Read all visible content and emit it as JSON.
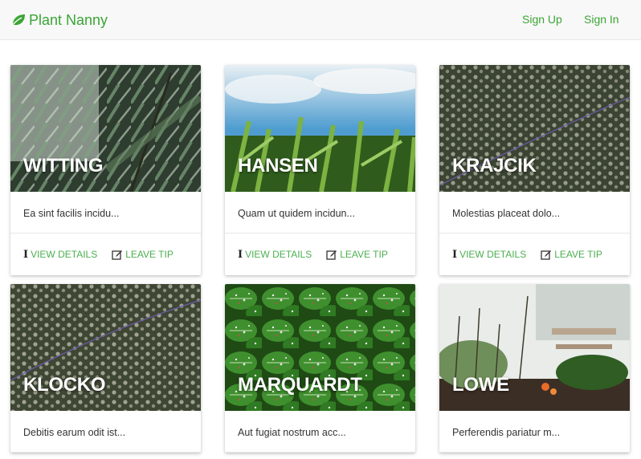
{
  "navbar": {
    "brand": "Plant Nanny",
    "sign_up": "Sign Up",
    "sign_in": "Sign In"
  },
  "colors": {
    "accent": "#3aa535",
    "action": "#4caf50"
  },
  "action_labels": {
    "details": "VIEW DETAILS",
    "tip": "LEAVE TIP"
  },
  "cards": [
    {
      "title": "WITTING",
      "excerpt": "Ea sint facilis incidu..."
    },
    {
      "title": "HANSEN",
      "excerpt": "Quam ut quidem incidun..."
    },
    {
      "title": "KRAJCIK",
      "excerpt": "Molestias placeat dolo..."
    },
    {
      "title": "KLOCKO",
      "excerpt": "Debitis earum odit ist..."
    },
    {
      "title": "MARQUARDT",
      "excerpt": "Aut fugiat nostrum acc..."
    },
    {
      "title": "LOWE",
      "excerpt": "Perferendis pariatur m..."
    }
  ]
}
